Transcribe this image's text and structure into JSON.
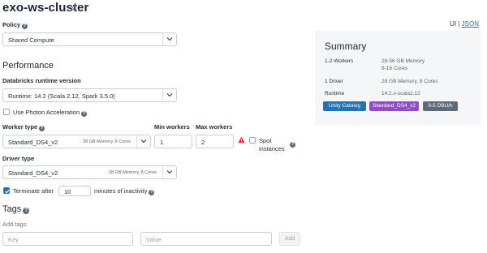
{
  "cluster": {
    "name": "exo-ws-cluster"
  },
  "view_toggle": {
    "ui": "UI",
    "sep": "|",
    "json": "JSON"
  },
  "policy": {
    "label": "Policy",
    "value": "Shared Compute"
  },
  "performance": {
    "heading": "Performance",
    "runtime_label": "Databricks runtime version",
    "runtime_value": "Runtime: 14.2 (Scala 2.12, Spark 3.5.0)",
    "photon_label": "Use Photon Acceleration",
    "photon_checked": false,
    "worker_type_label": "Worker type",
    "worker_type_value": "Standard_DS4_v2",
    "worker_type_meta": "28 GB Memory, 8 Cores",
    "min_workers_label": "Min workers",
    "min_workers_value": "1",
    "max_workers_label": "Max workers",
    "max_workers_value": "2",
    "spot_label_1": "Spot",
    "spot_label_2": "instances",
    "spot_checked": false,
    "driver_type_label": "Driver type",
    "driver_type_value": "Standard_DS4_v2",
    "driver_type_meta": "28 GB Memory, 8 Cores",
    "terminate_checked": true,
    "terminate_prefix": "Terminate after",
    "terminate_value": "10",
    "terminate_suffix": "minutes of inactivity"
  },
  "tags": {
    "heading": "Tags",
    "add_label": "Add tags",
    "key_placeholder": "Key",
    "value_placeholder": "Value",
    "add_button": "Add"
  },
  "summary": {
    "title": "Summary",
    "rows": [
      {
        "key": "1-2 Workers",
        "values": [
          "28-56 GB Memory",
          "8-16 Cores"
        ]
      },
      {
        "key": "1 Driver",
        "values": [
          "28 GB Memory, 8 Cores"
        ]
      },
      {
        "key": "Runtime",
        "values": [
          "14.2.x-scala2.12"
        ]
      }
    ],
    "badges": [
      {
        "label": "Unity Catalog",
        "color": "#2272b4"
      },
      {
        "label": "Standard_DS4_v2",
        "color": "#8e4ec6"
      },
      {
        "label": "3-5 DBU/h",
        "color": "#5f6b77"
      }
    ]
  },
  "colors": {
    "accent": "#2272b4",
    "warning": "#e02e3a"
  }
}
